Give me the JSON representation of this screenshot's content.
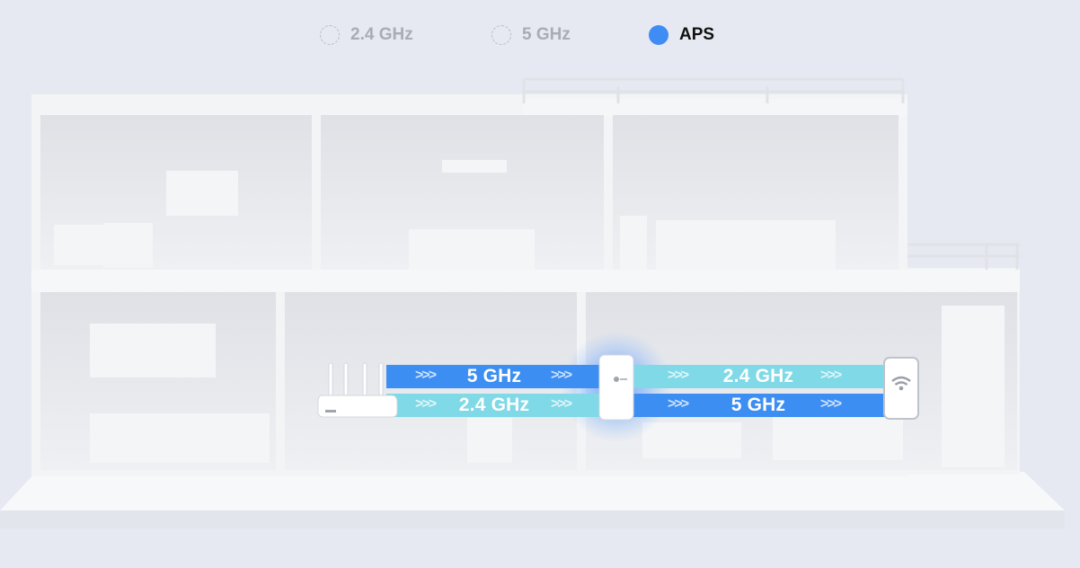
{
  "tabs": [
    {
      "label": "2.4 GHz",
      "active": false
    },
    {
      "label": "5 GHz",
      "active": false
    },
    {
      "label": "APS",
      "active": true
    }
  ],
  "colors": {
    "accent": "#3f8cf5",
    "band_blue": "#3d8ef3",
    "band_cyan": "#7fd9e6",
    "background": "#e6e9f1"
  },
  "bands": {
    "router_top": "5 GHz",
    "router_bottom": "2.4 GHz",
    "device_top": "2.4 GHz",
    "device_bottom": "5 GHz",
    "chevrons": ">>>"
  },
  "devices": {
    "router": "router-icon",
    "extender": "extender-icon",
    "client": "phone-wifi-icon"
  }
}
